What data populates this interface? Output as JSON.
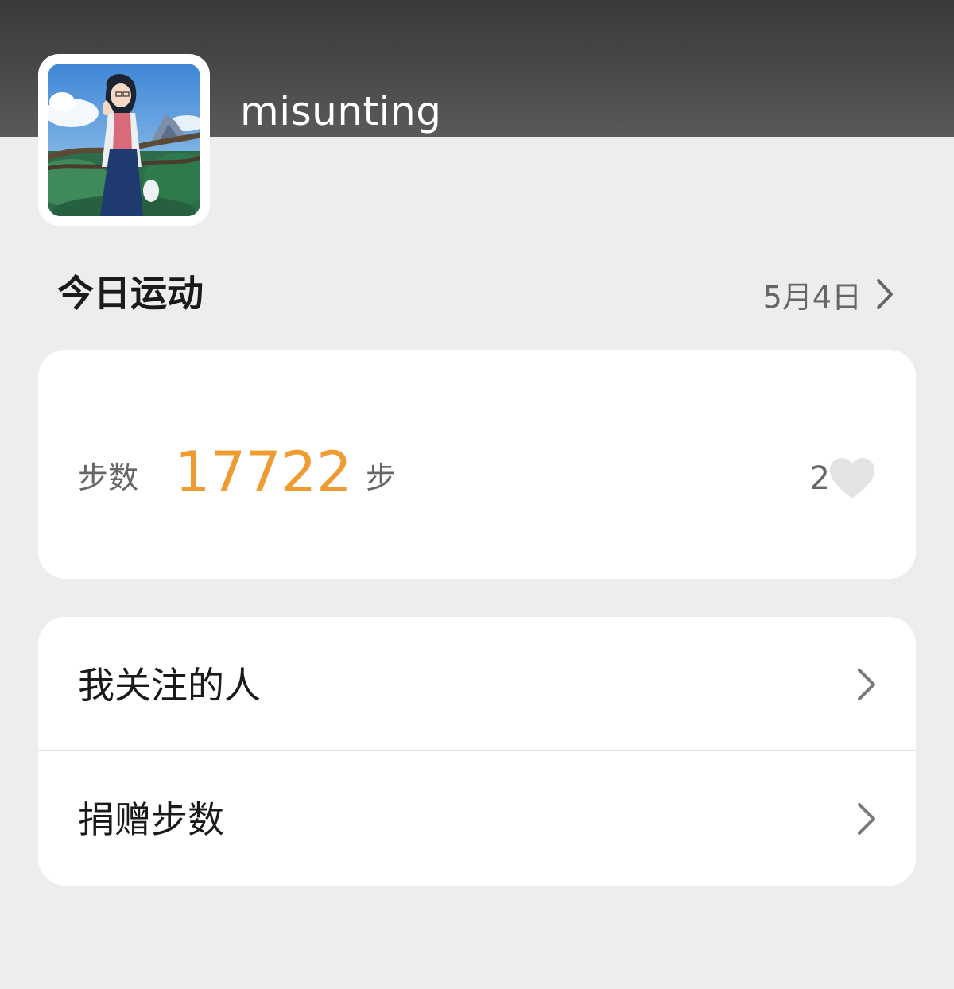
{
  "profile": {
    "username": "misunting",
    "avatar_icon": "avatar-illustration"
  },
  "today": {
    "title": "今日运动",
    "date": "5月4日"
  },
  "steps_card": {
    "label": "步数",
    "value": "17722",
    "unit": "步",
    "likes": "2",
    "value_color": "#ef9b2f"
  },
  "menu": {
    "items": [
      {
        "label": "我关注的人"
      },
      {
        "label": "捐赠步数"
      }
    ]
  }
}
